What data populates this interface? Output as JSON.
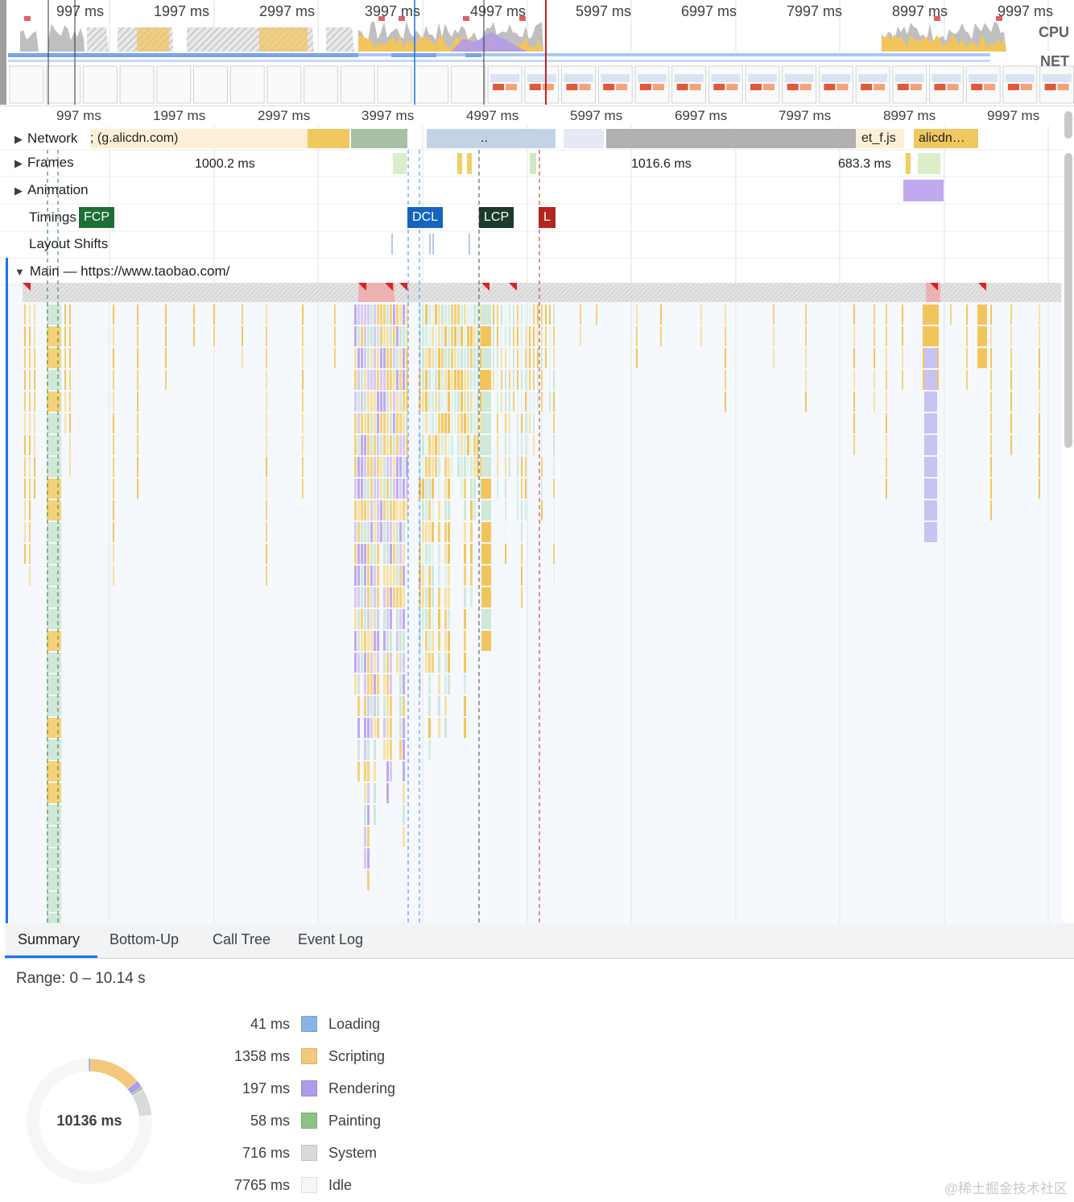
{
  "overview": {
    "time_labels": [
      "997 ms",
      "1997 ms",
      "2997 ms",
      "3997 ms",
      "4997 ms",
      "5997 ms",
      "6997 ms",
      "7997 ms",
      "8997 ms",
      "9997 ms"
    ],
    "cpu_label": "CPU",
    "net_label": "NET",
    "colors": {
      "scripting": "#f2c55c",
      "rendering": "#af9bec",
      "system": "#bfbfbf",
      "loading": "#8ab4f8",
      "network_bar": "#7aa5e8",
      "selection_line": "#c5221f",
      "nav_line": "#1a73e8"
    }
  },
  "ruler": {
    "labels": [
      "997 ms",
      "1997 ms",
      "2997 ms",
      "3997 ms",
      "4997 ms",
      "5997 ms",
      "6997 ms",
      "7997 ms",
      "8997 ms",
      "9997 ms"
    ]
  },
  "tracks": {
    "network": {
      "label": "Network",
      "items": [
        "; (g.alicdn.com)",
        "..",
        "et_f.js",
        "alicdn…"
      ]
    },
    "frames": {
      "label": "Frames",
      "durations": [
        "1000.2 ms",
        "1016.6 ms",
        "683.3 ms"
      ]
    },
    "animation": {
      "label": "Animation"
    },
    "timings": {
      "label": "Timings",
      "markers": [
        "FCP",
        "DCL",
        "LCP",
        "L"
      ]
    },
    "layout_shifts": {
      "label": "Layout Shifts"
    },
    "main": {
      "label": "Main — https://www.taobao.com/"
    }
  },
  "bottom": {
    "tabs": [
      "Summary",
      "Bottom-Up",
      "Call Tree",
      "Event Log"
    ],
    "active_tab": "Summary",
    "range": "Range: 0 – 10.14 s",
    "total": "10136 ms",
    "categories": [
      {
        "ms": "41 ms",
        "name": "Loading",
        "value": 41,
        "color": "#8ab4e8"
      },
      {
        "ms": "1358 ms",
        "name": "Scripting",
        "value": 1358,
        "color": "#f2c97a"
      },
      {
        "ms": "197 ms",
        "name": "Rendering",
        "value": 197,
        "color": "#af9bec"
      },
      {
        "ms": "58 ms",
        "name": "Painting",
        "value": 58,
        "color": "#8ec284"
      },
      {
        "ms": "716 ms",
        "name": "System",
        "value": 716,
        "color": "#dadada"
      },
      {
        "ms": "7765 ms",
        "name": "Idle",
        "value": 7765,
        "color": "#f6f6f6"
      }
    ]
  },
  "watermark": "@稀土掘金技术社区"
}
